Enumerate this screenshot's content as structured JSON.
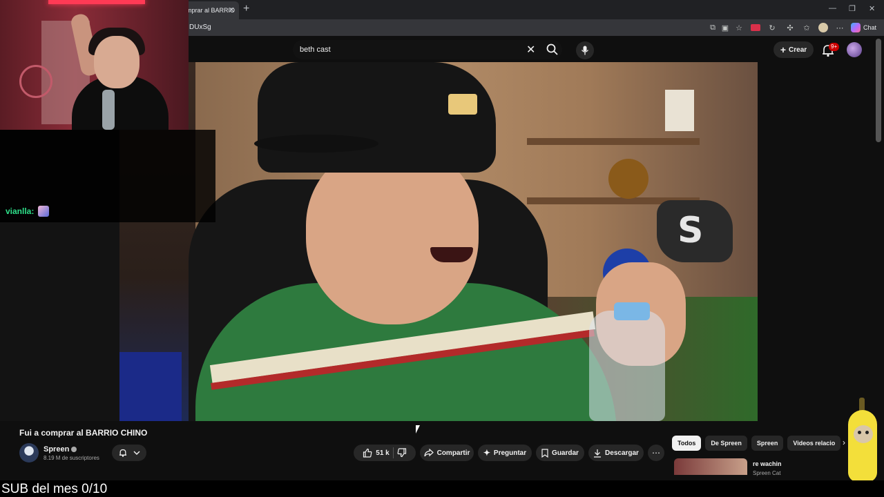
{
  "browser": {
    "tab_title": "mprar al BARRIO",
    "url": "DUxSg",
    "chat_label": "Chat",
    "notifications_badge": "9+"
  },
  "youtube": {
    "search_value": "beth cast",
    "create_label": "Crear"
  },
  "stream_overlay": {
    "chat_user": "vianlla:",
    "sub_goal": "SUB del mes 0/10"
  },
  "video": {
    "title": "Fui a comprar al BARRIO CHINO",
    "channel_name": "Spreen",
    "subscribers": "8.19 M de suscriptores",
    "like_count": "51 k",
    "share_label": "Compartir",
    "ask_label": "Preguntar",
    "save_label": "Guardar",
    "download_label": "Descargar"
  },
  "sidebar": {
    "chips": [
      "Todos",
      "De Spreen",
      "Spreen",
      "Videos relacio"
    ],
    "related_title": "re wachin",
    "related_channel": "Spreen Cat"
  },
  "colors": {
    "chat_user": "#2ee08a",
    "yt_background": "#0f0f0f",
    "notification_red": "#cc0000"
  }
}
